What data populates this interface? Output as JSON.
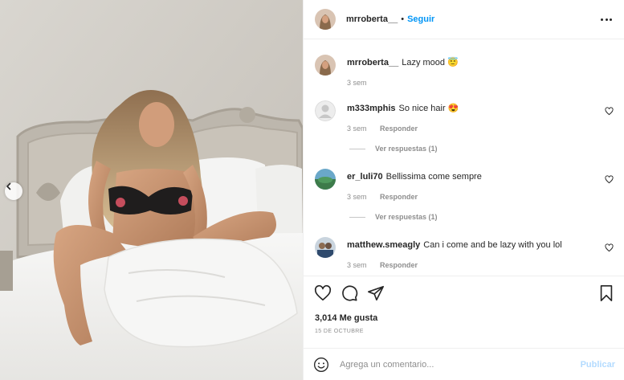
{
  "post": {
    "author": "mrroberta__",
    "separator": "•",
    "follow_label": "Seguir"
  },
  "comments": [
    {
      "user": "mrroberta__",
      "text": "Lazy mood",
      "emoji": "😇",
      "time": "3 sem"
    },
    {
      "user": "m333mphis",
      "text": "So nice hair",
      "emoji": "😍",
      "time": "3 sem",
      "reply_label": "Responder",
      "view_replies": "Ver respuestas (1)"
    },
    {
      "user": "er_luli70",
      "text": "Bellissima come sempre",
      "time": "3 sem",
      "reply_label": "Responder",
      "view_replies": "Ver respuestas (1)"
    },
    {
      "user": "matthew.smeagly",
      "text": "Can i come and be lazy with you lol",
      "time": "3 sem",
      "reply_label": "Responder"
    }
  ],
  "stats": {
    "likes": "3,014 Me gusta",
    "date": "15 DE OCTUBRE"
  },
  "composer": {
    "placeholder": "Agrega un comentario...",
    "publish_label": "Publicar"
  },
  "icons": {
    "prev": "chevron-left-icon",
    "more": "more-options-icon",
    "like": "heart-icon",
    "comment": "comment-icon",
    "share": "paper-plane-icon",
    "save": "bookmark-icon",
    "emoji": "smiley-icon"
  },
  "colors": {
    "link": "#0095f6",
    "muted": "#8e8e8e",
    "publish_disabled": "#b3dbff",
    "text": "#262626"
  }
}
